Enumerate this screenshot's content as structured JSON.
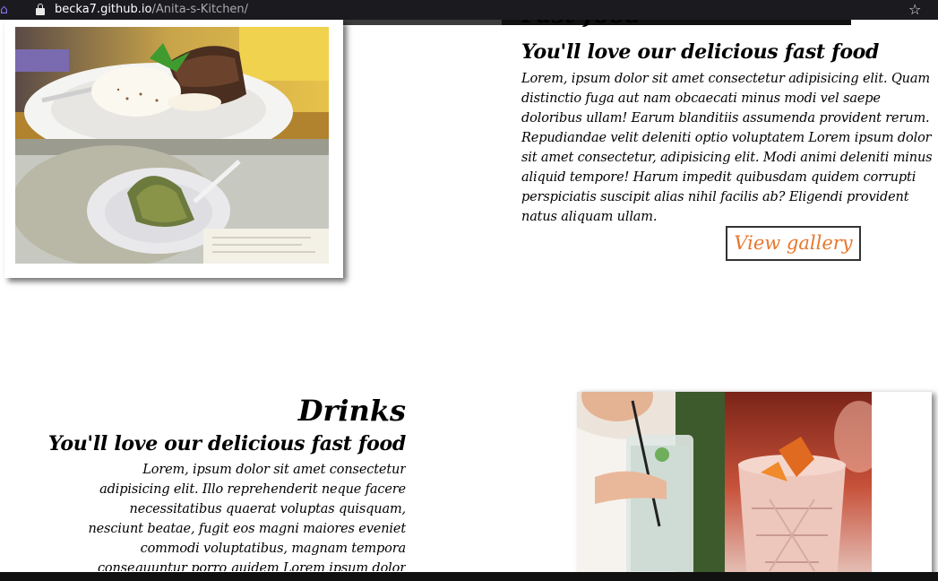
{
  "browser": {
    "url_host": "becka7.github.io",
    "url_path": "/Anita-s-Kitchen/"
  },
  "fast_food": {
    "title": "Fast food",
    "subtitle": "You'll love our delicious fast food",
    "body": "Lorem, ipsum dolor sit amet consectetur adipisicing elit. Quam distinctio fuga aut nam obcaecati minus modi vel saepe doloribus ullam! Earum blanditiis assumenda provident rerum. Repudiandae velit deleniti optio voluptatem Lorem ipsum dolor sit amet consectetur, adipisicing elit. Modi animi deleniti minus aliquid tempore! Harum impedit quibusdam quidem corrupti perspiciatis suscipit alias nihil facilis ab? Eligendi provident natus aliquam ullam.",
    "button_label": "View gallery"
  },
  "drinks": {
    "title": "Drinks",
    "subtitle": "You'll love our delicious fast food",
    "body": "Lorem, ipsum dolor sit amet consectetur adipisicing elit. Illo reprehenderit neque facere necessitatibus quaerat voluptas quisquam, nesciunt beatae, fugit eos magni maiores eveniet commodi voluptatibus, magnam tempora consequuntur porro quidem Lorem ipsum dolor"
  },
  "colors": {
    "accent": "#e8762c",
    "urlbar_bg": "#1b1b1f"
  }
}
